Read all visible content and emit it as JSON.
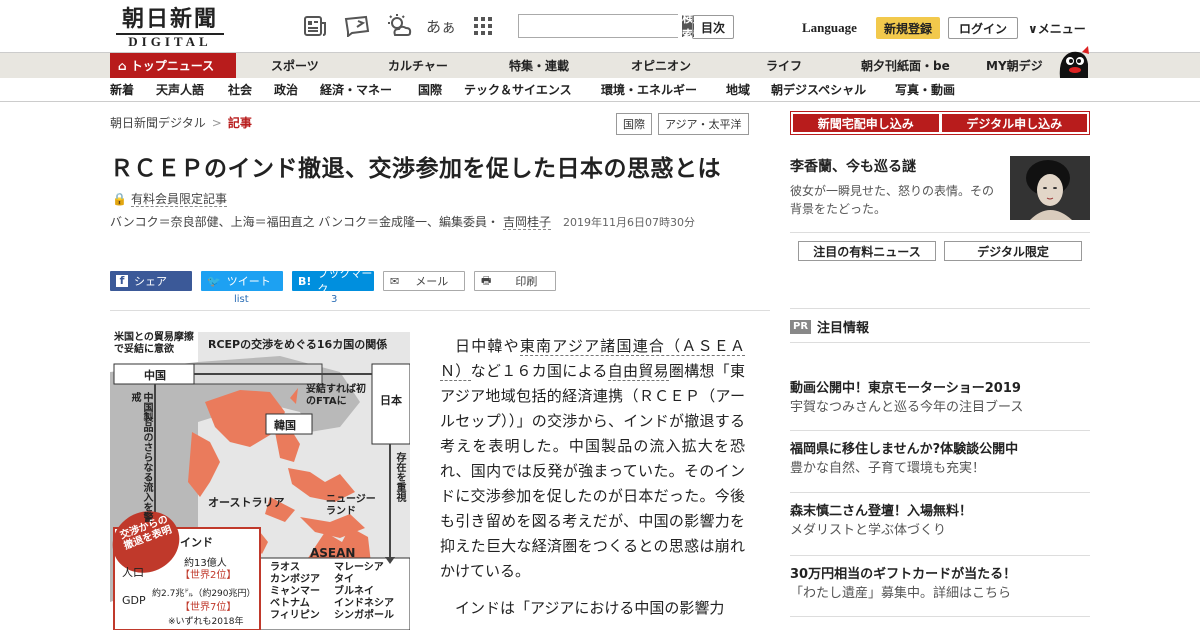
{
  "header": {
    "logo_line1": "朝日新聞",
    "logo_line2": "DIGITAL",
    "icons": [
      "newspaper-icon",
      "message-icon",
      "weather-icon",
      "font-size-icon",
      "grid-icon"
    ],
    "font_size_label": "あぁ",
    "search_placeholder": "",
    "search_button": "検 索",
    "index_button": "目次",
    "language": "Language",
    "register": "新規登録",
    "login": "ログイン",
    "menu": "∨メニュー"
  },
  "nav_primary": [
    "トップニュース",
    "スポーツ",
    "カルチャー",
    "特集・連載",
    "オピニオン",
    "ライフ",
    "朝夕刊紙面・be",
    "MY朝デジ"
  ],
  "nav_secondary": [
    "新着",
    "天声人語",
    "社会",
    "政治",
    "経済・マネー",
    "国際",
    "テック＆サイエンス",
    "環境・エネルギー",
    "地域",
    "朝デジスペシャル",
    "写真・動画"
  ],
  "breadcrumb": {
    "home": "朝日新聞デジタル",
    "sep": ">",
    "current": "記事"
  },
  "tags": [
    "国際",
    "アジア・太平洋"
  ],
  "article": {
    "title": "ＲＣＥＰのインド撤退、交渉参加を促した日本の思惑とは",
    "member_label": "有料会員限定記事",
    "byline": "バンコク＝奈良部健、上海＝福田直之 バンコク＝金成隆一、編集委員・",
    "author": "吉岡桂子",
    "date": "2019年11月6日07時30分",
    "p1_a": "日中韓や",
    "p1_link1": "東南アジア諸国連合（ＡＳＥＡＮ）",
    "p1_b": "など１６カ国による",
    "p1_link2": "自由貿易",
    "p1_c": "圏構想「東アジア地域包括的経済連携（ＲＣＥＰ（アールセップ））」の交渉から、インドが撤退する考えを表明した。中国製品の流入拡大を恐れ、国内では反発が強まっていた。そのインドに交渉参加を促したのが日本だった。今後も引き留めを図る考えだが、中国の影響力を抑えた巨大な経済圏をつくるとの思惑は崩れかけている。",
    "p2": "インドは「アジアにおける中国の影響力"
  },
  "share": {
    "facebook": "シェア",
    "twitter": "ツイート",
    "twitter_count": "list",
    "hatena": "ブックマーク",
    "hatena_count": "3",
    "mail": "メール",
    "print": "印刷"
  },
  "map": {
    "title": "RCEPの交渉をめぐる16カ国の関係",
    "us_note": "米国との貿易摩擦で妥結に意欲",
    "china": "中国",
    "japan": "日本",
    "korea": "韓国",
    "japan_note": "妥結すれば初のFTAに",
    "china_note": "中国製品のさらなる流入を警戒",
    "presence": "存在を重視",
    "australia": "オーストラリア",
    "nz": "ニュージーランド",
    "withdraw": "交渉からの撤退を表明",
    "india": "インド",
    "pop_label": "人口",
    "pop_val": "約13億人",
    "pop_rank": "【世界2位】",
    "gdp_label": "GDP",
    "gdp_val": "約2.7兆㌦（約290兆円）",
    "gdp_rank": "【世界7位】",
    "note": "※いずれも2018年",
    "asean": "ASEAN",
    "asean_members": [
      "ラオス",
      "マレーシア",
      "カンボジア",
      "タイ",
      "ミャンマー",
      "ブルネイ",
      "ベトナム",
      "インドネシア",
      "フィリピン",
      "シンガポール"
    ]
  },
  "sidebar": {
    "btn1": "新聞宅配申し込み",
    "btn2": "デジタル申し込み",
    "promo_title": "李香蘭、今も巡る謎",
    "promo_desc": "彼女が一瞬見せた、怒りの表情。その背景をたどった。",
    "tab1": "注目の有料ニュース",
    "tab2": "デジタル限定",
    "pr_badge": "PR",
    "pr_title": "注目情報",
    "ads": [
      {
        "title": "動画公開中！東京モーターショー2019",
        "desc": "宇賀なつみさんと巡る今年の注目ブース"
      },
      {
        "title": "福岡県に移住しませんか?体験談公開中",
        "desc": "豊かな自然、子育て環境も充実！"
      },
      {
        "title": "森末慎二さん登壇！入場無料！",
        "desc": "メダリストと学ぶ体づくり"
      },
      {
        "title": "30万円相当のギフトカードが当たる！",
        "desc": "「わたし遺産」募集中。詳細はこちら"
      }
    ]
  }
}
